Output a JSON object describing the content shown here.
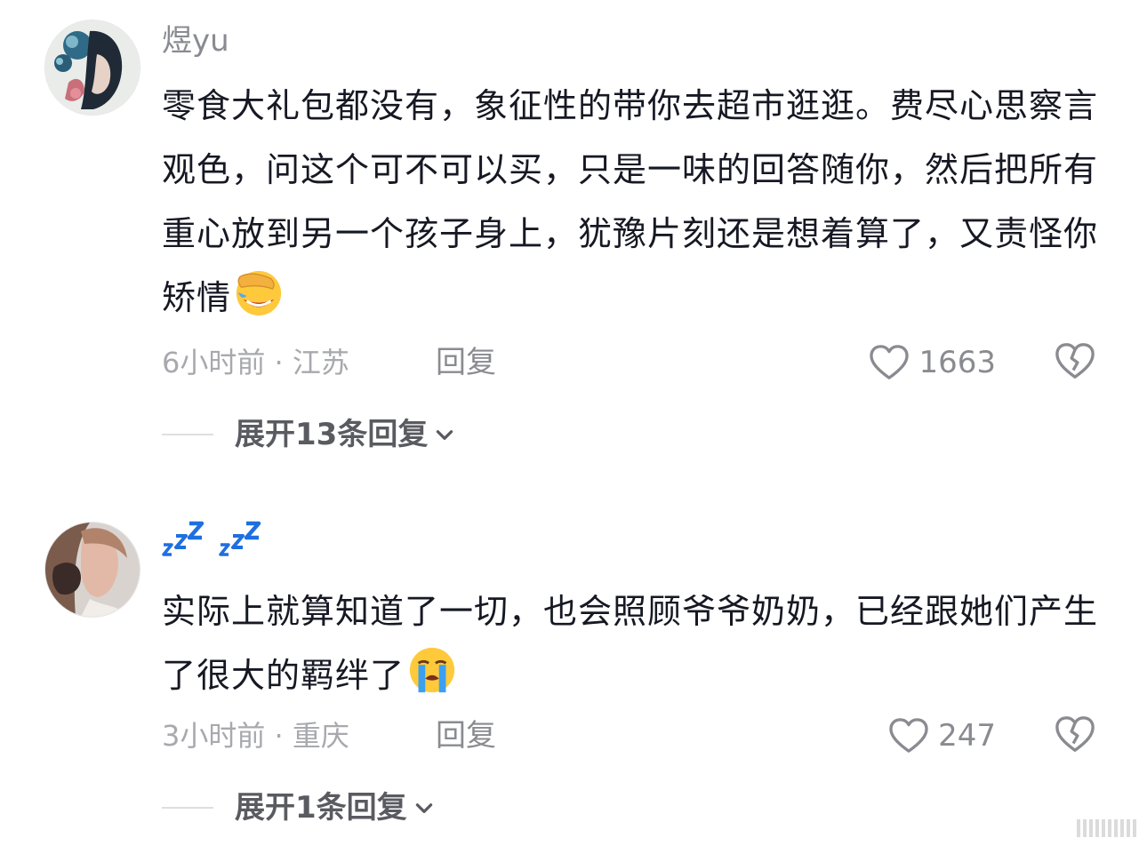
{
  "comments": [
    {
      "username": "煜yu",
      "text": "零食大礼包都没有，象征性的带你去超市逛逛。费尽心思察言观色，问这个可不可以买，只是一味的回答随你，然后把所有重心放到另一个孩子身上，犹豫片刻还是想着算了，又责怪你矫情",
      "emoji": "facepalm-laugh-emoji",
      "time_location": "6小时前 · 江苏",
      "reply_label": "回复",
      "likes": "1663",
      "expand_label": "展开13条回复"
    },
    {
      "username": "zZ zZ",
      "text": "实际上就算知道了一切，也会照顾爷爷奶奶，已经跟她们产生了很大的羁绊了",
      "emoji": "loudly-crying-emoji",
      "time_location": "3小时前 · 重庆",
      "reply_label": "回复",
      "likes": "247",
      "expand_label": "展开1条回复"
    }
  ],
  "colors": {
    "text": "#161823",
    "muted": "#8a8b91",
    "light": "#a8a9ae",
    "zz_blue": "#1f6fe0"
  },
  "icons": [
    "heart-icon",
    "broken-heart-icon",
    "chevron-down-icon",
    "sleep-zz-icon"
  ]
}
